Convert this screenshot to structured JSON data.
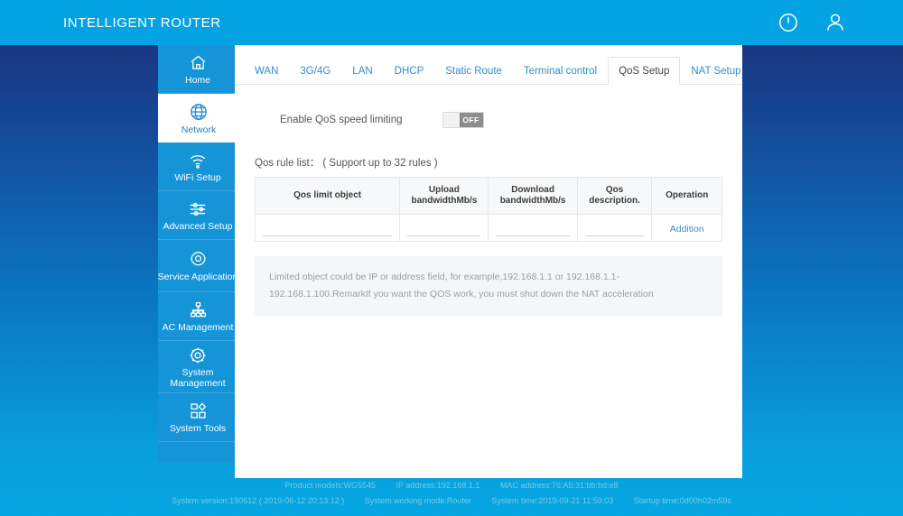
{
  "header": {
    "brand": "INTELLIGENT ROUTER",
    "power_icon": "power-icon",
    "user_icon": "user-icon"
  },
  "sidebar": {
    "items": [
      {
        "label": "Home",
        "icon": "home-icon",
        "active": false
      },
      {
        "label": "Network",
        "icon": "globe-icon",
        "active": true
      },
      {
        "label": "WiFi Setup",
        "icon": "wifi-icon",
        "active": false
      },
      {
        "label": "Advanced Setup",
        "icon": "sliders-icon",
        "active": false
      },
      {
        "label": "Service Application",
        "icon": "service-icon",
        "active": false
      },
      {
        "label": "AC Management",
        "icon": "sitemap-icon",
        "active": false
      },
      {
        "label": "System Management",
        "icon": "gear-icon",
        "active": false
      },
      {
        "label": "System Tools",
        "icon": "grid-icon",
        "active": false
      }
    ]
  },
  "tabs": [
    {
      "label": "WAN",
      "active": false
    },
    {
      "label": "3G/4G",
      "active": false
    },
    {
      "label": "LAN",
      "active": false
    },
    {
      "label": "DHCP",
      "active": false
    },
    {
      "label": "Static Route",
      "active": false
    },
    {
      "label": "Terminal control",
      "active": false
    },
    {
      "label": "QoS Setup",
      "active": true
    },
    {
      "label": "NAT Setup",
      "active": false
    }
  ],
  "qos": {
    "enable_label": "Enable QoS speed limiting",
    "toggle_state": "OFF",
    "rule_list_title": "Qos rule list： ( Support up to 32 rules )",
    "columns": [
      "Qos limit object",
      "Upload bandwidthMb/s",
      "Download bandwidthMb/s",
      "Qos description.",
      "Operation"
    ],
    "rows": [
      {
        "limit_object": "",
        "upload": "",
        "download": "",
        "description": "",
        "operation": "Addition"
      }
    ],
    "remark": "Limited object could be IP or address field, for example,192.168.1.1 or 192.168.1.1-192.168.1.100.RemarkIf you want the QOS work, you must shut down the NAT acceleration"
  },
  "footer": {
    "line1": {
      "product_model": "Product models:WG5545",
      "ip_address": "IP address:192.168.1.1",
      "mac_address": "MAC address:76:A5:31:bb:bd:e8"
    },
    "line2": {
      "system_version": "System version:190612 ( 2019-06-12 20:13:12 )",
      "working_mode": "System working mode:Router",
      "system_time": "System time:2019-09-21 11:59:03",
      "startup_time": "Startup time:0d00h02m59s"
    }
  },
  "colors": {
    "brand_bar": "#03a3e3",
    "sidebar": "#1594d8",
    "accent_link": "#3d8ecb",
    "toggle_off": "#8d8d8d"
  }
}
